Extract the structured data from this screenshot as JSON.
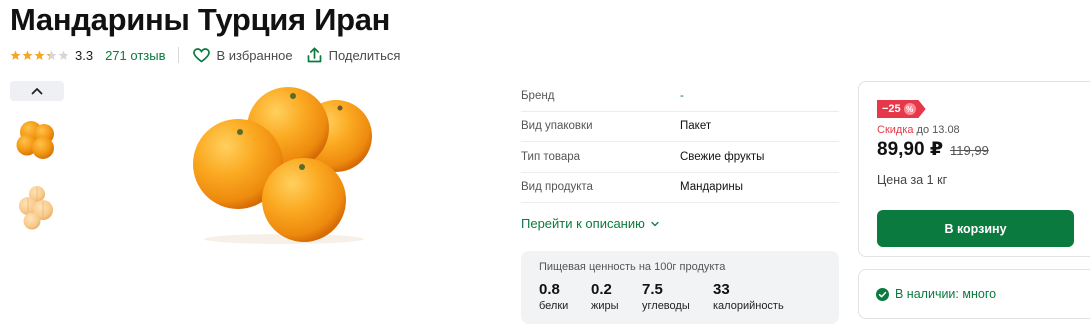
{
  "product": {
    "title": "Мандарины Турция Иран"
  },
  "rating": {
    "value": "3.3",
    "score": 3.3,
    "max": 5,
    "reviews": "271 отзыв",
    "star_color": "#f5a623"
  },
  "actions": {
    "favorite": "В избранное",
    "share": "Поделиться"
  },
  "gallery": {
    "up_icon": "chevron-up-icon",
    "thumbnails": [
      "mandarins-whole",
      "mandarins-peeled"
    ]
  },
  "specs": [
    {
      "label": "Бренд",
      "value": "-"
    },
    {
      "label": "Вид упаковки",
      "value": "Пакет"
    },
    {
      "label": "Тип товара",
      "value": "Свежие фрукты"
    },
    {
      "label": "Вид продукта",
      "value": "Мандарины"
    }
  ],
  "description_link": "Перейти к описанию",
  "nutrition": {
    "title": "Пищевая ценность на 100г продукта",
    "items": [
      {
        "value": "0.8",
        "label": "белки"
      },
      {
        "value": "0.2",
        "label": "жиры"
      },
      {
        "value": "7.5",
        "label": "углеводы"
      },
      {
        "value": "33",
        "label": "калорийность"
      }
    ]
  },
  "price": {
    "badge": "−25",
    "badge_pct": "%",
    "discount_word": "Скидка",
    "discount_until": " до 13.08",
    "current": "89,90 ₽",
    "old": "119,99",
    "unit": "Цена за 1 кг",
    "cart_button": "В корзину"
  },
  "stock": {
    "text": "В наличии: много"
  },
  "colors": {
    "accent": "#0a7a3e",
    "discount": "#e53949"
  }
}
